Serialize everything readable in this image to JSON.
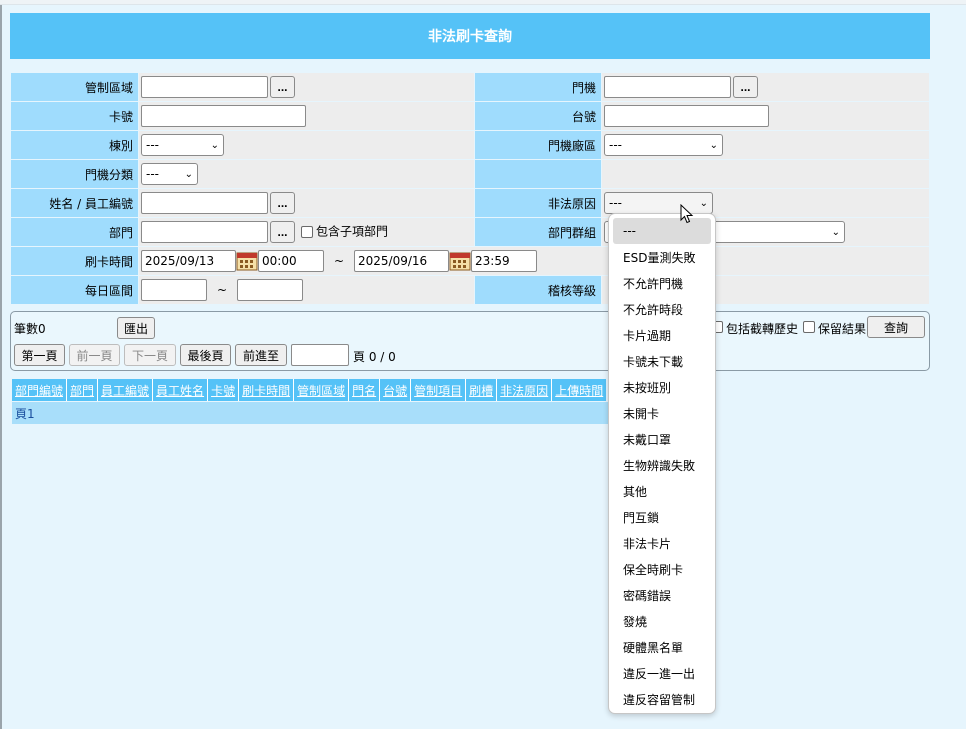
{
  "title": "非法刷卡查詢",
  "form": {
    "control_area_label": "管制區域",
    "door_label": "門機",
    "card_no_label": "卡號",
    "reader_no_label": "台號",
    "building_label": "棟別",
    "building_value": "---",
    "door_area_label": "門機廠區",
    "door_area_value": "---",
    "door_category_label": "門機分類",
    "door_category_value": "---",
    "name_label": "姓名 / 員工編號",
    "illegal_reason_label": "非法原因",
    "illegal_reason_value": "---",
    "dept_label": "部門",
    "include_sub_dept_label": "包含子項部門",
    "dept_group_label": "部門群組",
    "swipe_time_label": "刷卡時間",
    "start_date": "2025/09/13",
    "start_time": "00:00",
    "tilde": "~",
    "end_date": "2025/09/16",
    "end_time": "23:59",
    "daily_range_label": "每日區間",
    "audit_level_label": "稽核等級",
    "dots": "..."
  },
  "toolbar": {
    "count_label": "筆數0",
    "export_label": "匯出",
    "first_page_label": "第一頁",
    "prev_page_label": "前一頁",
    "next_page_label": "下一頁",
    "last_page_label": "最後頁",
    "goto_label": "前進至",
    "page_info": "頁 0 / 0",
    "include_history_label": "包括截轉歷史",
    "keep_result_label": "保留結果",
    "query_label": "查詢"
  },
  "grid": {
    "columns": [
      "部門編號",
      "部門",
      "員工編號",
      "員工姓名",
      "卡號",
      "刷卡時間",
      "管制區域",
      "門名",
      "台號",
      "管制項目",
      "刷槽",
      "非法原因",
      "上傳時間"
    ],
    "pager_text": "頁1"
  },
  "dropdown": {
    "options": [
      "---",
      "ESD量測失敗",
      "不允許門機",
      "不允許時段",
      "卡片過期",
      "卡號未下載",
      "未按班別",
      "未開卡",
      "未戴口罩",
      "生物辨識失敗",
      "其他",
      "門互鎖",
      "非法卡片",
      "保全時刷卡",
      "密碼錯誤",
      "發燒",
      "硬體黑名單",
      "違反一進一出",
      "違反容留管制"
    ],
    "selected_index": 0
  },
  "colors": {
    "header_blue": "#55c2f7",
    "label_blue": "#9fdcfd",
    "page_bg": "#e6f5fd"
  }
}
